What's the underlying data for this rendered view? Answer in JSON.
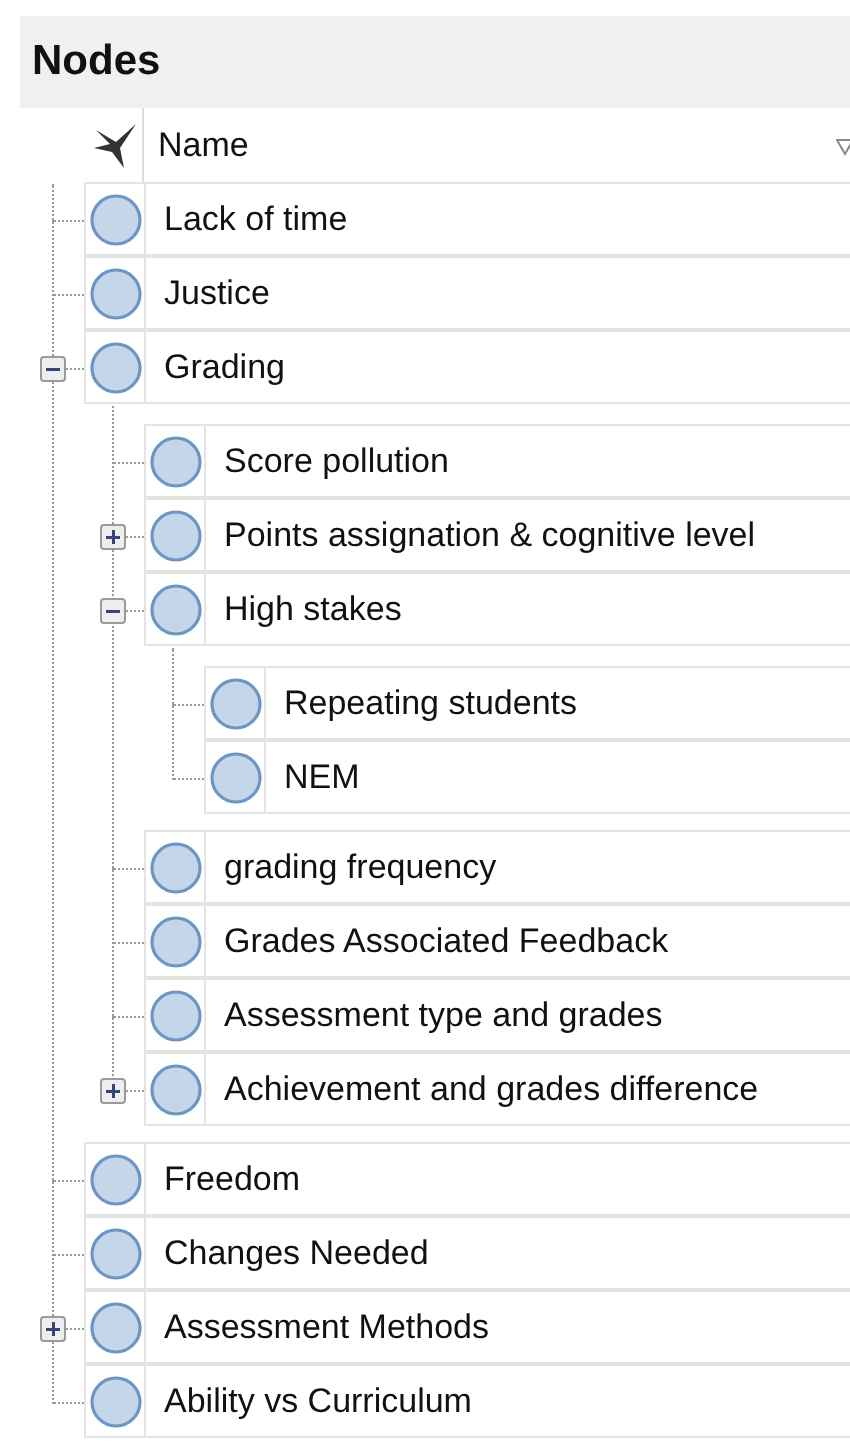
{
  "panel": {
    "title": "Nodes"
  },
  "table": {
    "columns": [
      {
        "label": "Name"
      }
    ]
  },
  "nodes": [
    {
      "name": "Lack of time"
    },
    {
      "name": "Justice"
    },
    {
      "name": "Grading",
      "expanded": true,
      "children": [
        {
          "name": "Score pollution"
        },
        {
          "name": "Points assignation & cognitive level",
          "expanded": false
        },
        {
          "name": "High stakes",
          "expanded": true,
          "children": [
            {
              "name": "Repeating students"
            },
            {
              "name": "NEM"
            }
          ]
        },
        {
          "name": "grading frequency"
        },
        {
          "name": "Grades Associated Feedback"
        },
        {
          "name": "Assessment type and grades"
        },
        {
          "name": "Achievement and grades difference",
          "expanded": false
        }
      ]
    },
    {
      "name": "Freedom"
    },
    {
      "name": "Changes Needed"
    },
    {
      "name": "Assessment Methods",
      "expanded": false
    },
    {
      "name": "Ability vs Curriculum"
    }
  ]
}
